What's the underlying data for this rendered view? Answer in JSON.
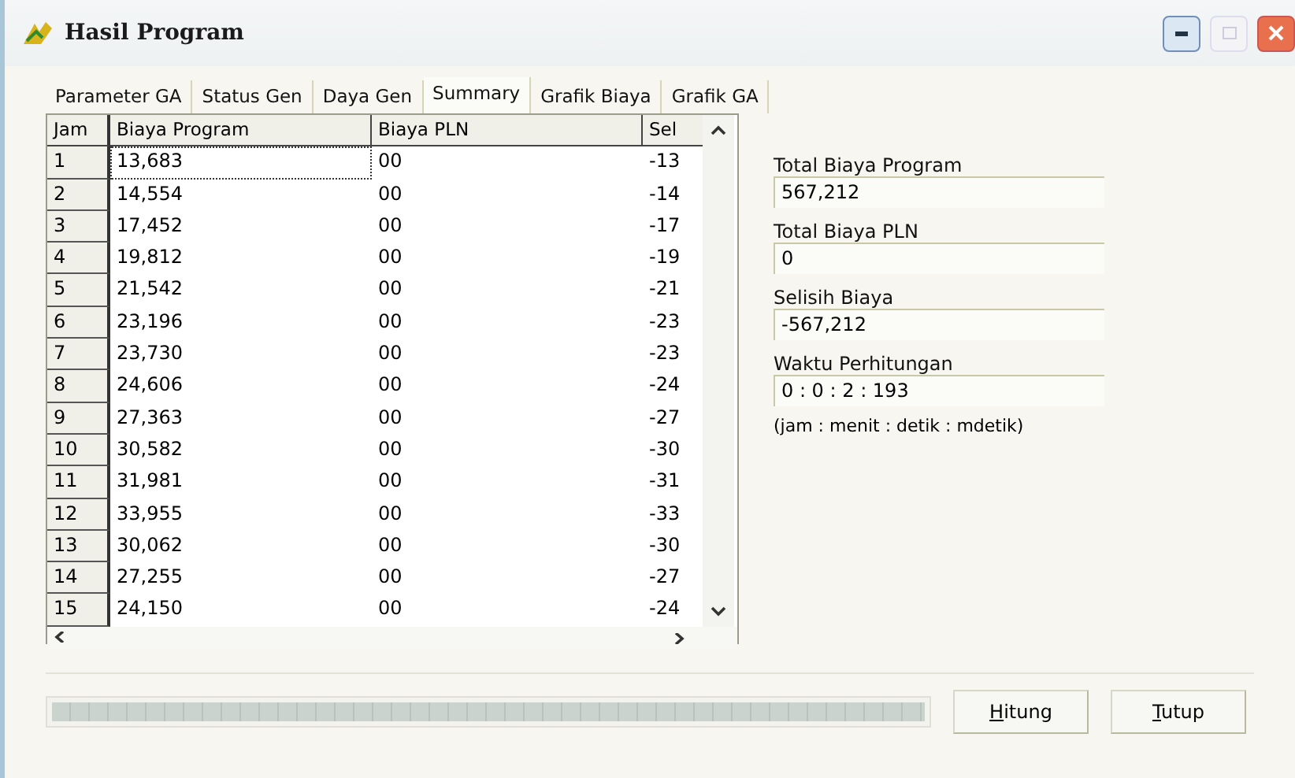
{
  "window": {
    "title": "Hasil Program"
  },
  "tabs": [
    {
      "label": "Parameter GA",
      "selected": false
    },
    {
      "label": "Status Gen",
      "selected": false
    },
    {
      "label": "Daya Gen",
      "selected": false
    },
    {
      "label": "Summary",
      "selected": true
    },
    {
      "label": "Grafik Biaya",
      "selected": false
    },
    {
      "label": "Grafik GA",
      "selected": false
    }
  ],
  "table": {
    "columns": [
      "Jam",
      "Biaya Program",
      "Biaya PLN",
      "Sel"
    ],
    "rows": [
      {
        "cells": [
          "1",
          "13,683",
          "00",
          "-13"
        ],
        "focused": true
      },
      {
        "cells": [
          "2",
          "14,554",
          "00",
          "-14"
        ],
        "focused": false
      },
      {
        "cells": [
          "3",
          "17,452",
          "00",
          "-17"
        ],
        "focused": false
      },
      {
        "cells": [
          "4",
          "19,812",
          "00",
          "-19"
        ],
        "focused": false
      },
      {
        "cells": [
          "5",
          "21,542",
          "00",
          "-21"
        ],
        "focused": false
      },
      {
        "cells": [
          "6",
          "23,196",
          "00",
          "-23"
        ],
        "focused": false
      },
      {
        "cells": [
          "7",
          "23,730",
          "00",
          "-23"
        ],
        "focused": false
      },
      {
        "cells": [
          "8",
          "24,606",
          "00",
          "-24"
        ],
        "focused": false
      },
      {
        "cells": [
          "9",
          "27,363",
          "00",
          "-27"
        ],
        "focused": false
      },
      {
        "cells": [
          "10",
          "30,582",
          "00",
          "-30"
        ],
        "focused": false
      },
      {
        "cells": [
          "11",
          "31,981",
          "00",
          "-31"
        ],
        "focused": false
      },
      {
        "cells": [
          "12",
          "33,955",
          "00",
          "-33"
        ],
        "focused": false
      },
      {
        "cells": [
          "13",
          "30,062",
          "00",
          "-30"
        ],
        "focused": false
      },
      {
        "cells": [
          "14",
          "27,255",
          "00",
          "-27"
        ],
        "focused": false
      },
      {
        "cells": [
          "15",
          "24,150",
          "00",
          "-24"
        ],
        "focused": false
      }
    ]
  },
  "summary": [
    {
      "label": "Total Biaya Program",
      "value": "567,212"
    },
    {
      "label": "Total Biaya PLN",
      "value": "0"
    },
    {
      "label": "Selisih Biaya",
      "value": "-567,212"
    },
    {
      "label": "Waktu Perhitungan",
      "value": "0 : 0 : 2 : 193"
    }
  ],
  "summary_note": "(jam : menit : detik : mdetik)",
  "progress": {
    "level": 1
  },
  "buttons": [
    "Hitung",
    "Tutup"
  ]
}
